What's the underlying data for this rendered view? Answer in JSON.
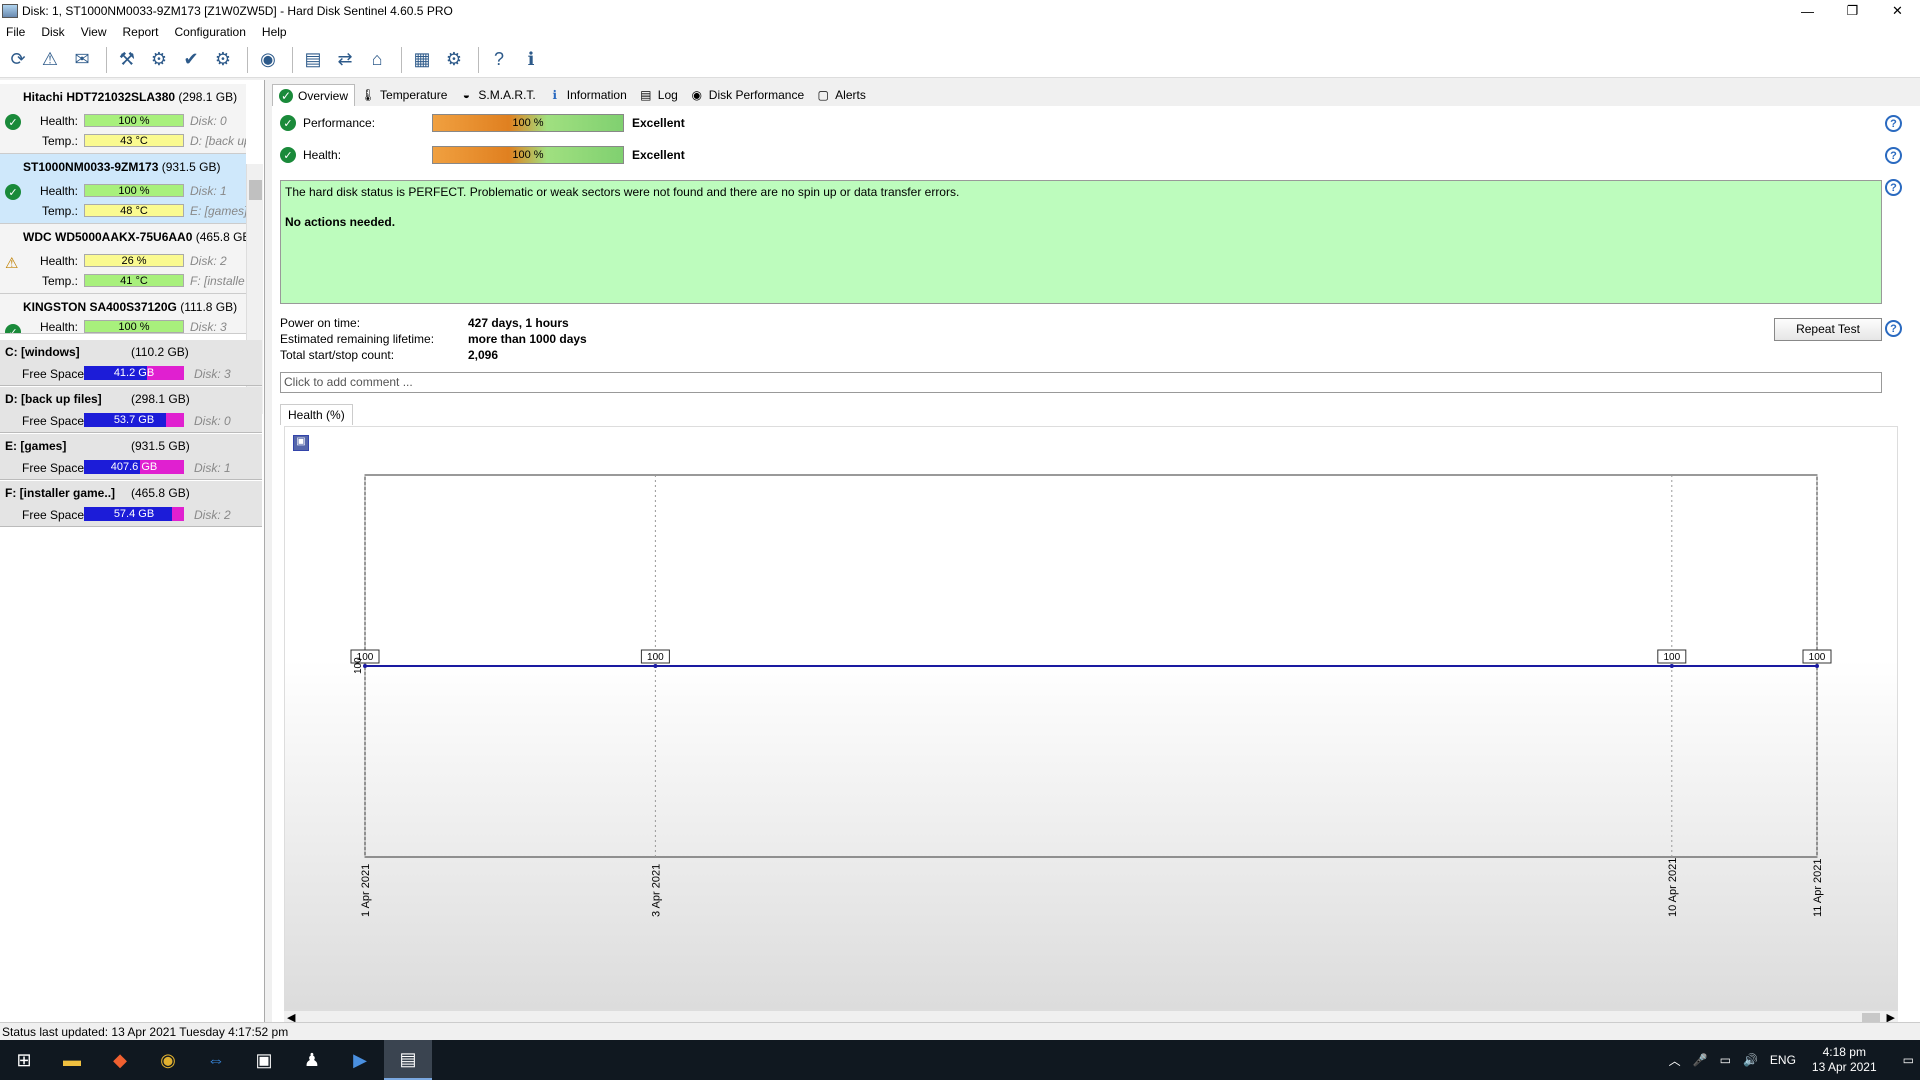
{
  "window": {
    "title": "Disk: 1, ST1000NM0033-9ZM173 [Z1W0ZW5D]  -  Hard Disk Sentinel 4.60.5 PRO",
    "min": "—",
    "max": "❐",
    "close": "✕"
  },
  "menu": [
    "File",
    "Disk",
    "View",
    "Report",
    "Configuration",
    "Help"
  ],
  "toolbar_icons": [
    "refresh-icon",
    "alert-icon",
    "report-icon",
    "disk-test-icon",
    "disk-surface-icon",
    "disk-check-icon",
    "disk-config-icon",
    "web-icon",
    "document-icon",
    "sync-icon",
    "network-icon",
    "chip-icon",
    "settings-icon",
    "help-icon",
    "info-icon"
  ],
  "disks": [
    {
      "name": "Hitachi HDT721032SLA380",
      "size": "(298.1 GB)",
      "health_label": "Health:",
      "health": "100 %",
      "health_frac": 1.0,
      "temp_label": "Temp.:",
      "temp": "43 °C",
      "disk": "Disk: 0",
      "vol": "D: [back up",
      "status": "ok"
    },
    {
      "name": "ST1000NM0033-9ZM173",
      "size": "(931.5 GB)",
      "health_label": "Health:",
      "health": "100 %",
      "health_frac": 1.0,
      "temp_label": "Temp.:",
      "temp": "48 °C",
      "disk": "Disk: 1",
      "vol": "E: [games]",
      "status": "ok"
    },
    {
      "name": "WDC WD5000AAKX-75U6AA0",
      "size": "(465.8 GB)",
      "health_label": "Health:",
      "health": "26 %",
      "health_frac": 0.26,
      "temp_label": "Temp.:",
      "temp": "41 °C",
      "disk": "Disk: 2",
      "vol": "F: [installe",
      "status": "warn"
    },
    {
      "name": "KINGSTON SA400S37120G",
      "size": "(111.8 GB)",
      "health_label": "Health:",
      "health": "100 %",
      "health_frac": 1.0,
      "temp_label": "",
      "temp": "",
      "disk": "Disk: 3",
      "vol": "",
      "status": "ok"
    }
  ],
  "volumes": [
    {
      "name": "C: [windows]",
      "size": "(110.2 GB)",
      "fs": "Free Space",
      "free": "41.2 GB",
      "free_frac": 0.37,
      "disk": "Disk: 3"
    },
    {
      "name": "D: [back up files]",
      "size": "(298.1 GB)",
      "fs": "Free Space",
      "free": "53.7 GB",
      "free_frac": 0.18,
      "disk": "Disk: 0"
    },
    {
      "name": "E: [games]",
      "size": "(931.5 GB)",
      "fs": "Free Space",
      "free": "407.6 GB",
      "free_frac": 0.44,
      "disk": "Disk: 1"
    },
    {
      "name": "F: [installer game..]",
      "size": "(465.8 GB)",
      "fs": "Free Space",
      "free": "57.4 GB",
      "free_frac": 0.12,
      "disk": "Disk: 2"
    }
  ],
  "tabs": [
    "Overview",
    "Temperature",
    "S.M.A.R.T.",
    "Information",
    "Log",
    "Disk Performance",
    "Alerts"
  ],
  "overview": {
    "perf_label": "Performance:",
    "perf": "100 %",
    "perf_verdict": "Excellent",
    "health_label": "Health:",
    "health": "100 %",
    "health_verdict": "Excellent",
    "msg1": "The hard disk status is PERFECT. Problematic or weak sectors were not found and there are no spin up or data transfer errors.",
    "msg2": "No actions needed.",
    "power_label": "Power on time:",
    "power": "427 days, 1 hours",
    "life_label": "Estimated remaining lifetime:",
    "life": "more than 1000 days",
    "starts_label": "Total start/stop count:",
    "starts": "2,096",
    "repeat_btn": "Repeat Test",
    "comment_placeholder": "Click to add comment ...",
    "chart_tab": "Health (%)"
  },
  "chart_data": {
    "type": "line",
    "x": [
      "1 Apr 2021",
      "3 Apr 2021",
      "10 Apr 2021",
      "11 Apr 2021"
    ],
    "values": [
      100,
      100,
      100,
      100
    ],
    "data_labels": [
      "100",
      "100",
      "100",
      "100"
    ],
    "ylabel_tick": "100",
    "line_color": "#1a1aa0"
  },
  "status": "Status last updated: 13 Apr 2021 Tuesday 4:17:52 pm",
  "taskbar": {
    "lang": "ENG",
    "time": "4:18 pm",
    "date": "13 Apr 2021"
  }
}
